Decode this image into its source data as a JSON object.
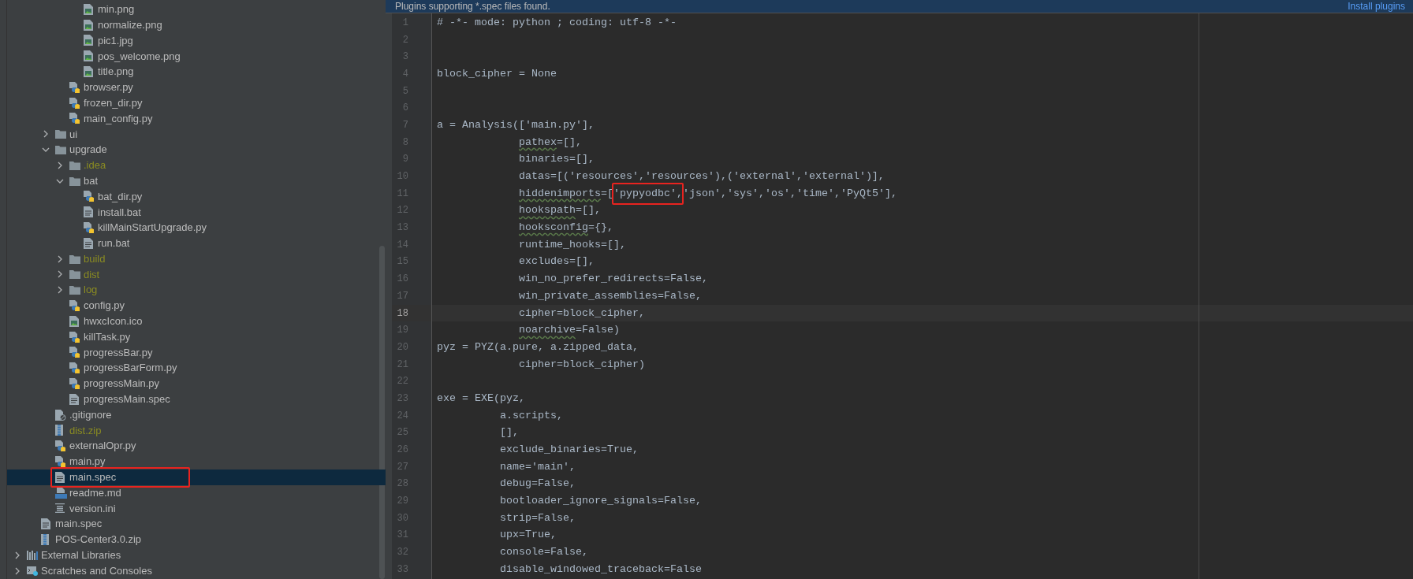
{
  "project_tree": [
    {
      "children": [
        {
          "children": [
            {
              "children": [
                {
                  "children": [
                    {
                      "label": "min.png",
                      "kind": "image",
                      "selected": false,
                      "ignored": false,
                      "boxed": false
                    },
                    {
                      "label": "normalize.png",
                      "kind": "image",
                      "selected": false,
                      "ignored": false,
                      "boxed": false
                    },
                    {
                      "label": "pic1.jpg",
                      "kind": "image",
                      "selected": false,
                      "ignored": false,
                      "boxed": false
                    },
                    {
                      "label": "pos_welcome.png",
                      "kind": "image",
                      "selected": false,
                      "ignored": false,
                      "boxed": false
                    },
                    {
                      "label": "title.png",
                      "kind": "image",
                      "selected": false,
                      "ignored": false,
                      "boxed": false
                    }
                  ]
                },
                {
                  "label": "browser.py",
                  "kind": "python",
                  "selected": false,
                  "ignored": false,
                  "boxed": false
                },
                {
                  "label": "frozen_dir.py",
                  "kind": "python",
                  "selected": false,
                  "ignored": false,
                  "boxed": false
                },
                {
                  "label": "main_config.py",
                  "kind": "python",
                  "selected": false,
                  "ignored": false,
                  "boxed": false
                }
              ]
            },
            {
              "label": "ui",
              "kind": "folder",
              "expanded": false,
              "selected": false,
              "ignored": false,
              "boxed": false
            },
            {
              "label": "upgrade",
              "kind": "folder",
              "expanded": true,
              "selected": false,
              "ignored": false,
              "boxed": false,
              "children": [
                {
                  "label": ".idea",
                  "kind": "folder",
                  "expanded": false,
                  "selected": false,
                  "ignored": true,
                  "boxed": false
                },
                {
                  "label": "bat",
                  "kind": "folder",
                  "expanded": true,
                  "selected": false,
                  "ignored": false,
                  "boxed": false,
                  "children": [
                    {
                      "label": "bat_dir.py",
                      "kind": "python",
                      "selected": false,
                      "ignored": false,
                      "boxed": false
                    },
                    {
                      "label": "install.bat",
                      "kind": "text",
                      "selected": false,
                      "ignored": false,
                      "boxed": false
                    },
                    {
                      "label": "killMainStartUpgrade.py",
                      "kind": "python",
                      "selected": false,
                      "ignored": false,
                      "boxed": false
                    },
                    {
                      "label": "run.bat",
                      "kind": "text",
                      "selected": false,
                      "ignored": false,
                      "boxed": false
                    }
                  ]
                },
                {
                  "label": "build",
                  "kind": "folder",
                  "expanded": false,
                  "selected": false,
                  "ignored": true,
                  "boxed": false
                },
                {
                  "label": "dist",
                  "kind": "folder",
                  "expanded": false,
                  "selected": false,
                  "ignored": true,
                  "boxed": false
                },
                {
                  "label": "log",
                  "kind": "folder",
                  "expanded": false,
                  "selected": false,
                  "ignored": true,
                  "boxed": false
                },
                {
                  "label": "config.py",
                  "kind": "python",
                  "selected": false,
                  "ignored": false,
                  "boxed": false
                },
                {
                  "label": "hwxcIcon.ico",
                  "kind": "image",
                  "selected": false,
                  "ignored": false,
                  "boxed": false
                },
                {
                  "label": "killTask.py",
                  "kind": "python",
                  "selected": false,
                  "ignored": false,
                  "boxed": false
                },
                {
                  "label": "progressBar.py",
                  "kind": "python",
                  "selected": false,
                  "ignored": false,
                  "boxed": false
                },
                {
                  "label": "progressBarForm.py",
                  "kind": "python",
                  "selected": false,
                  "ignored": false,
                  "boxed": false
                },
                {
                  "label": "progressMain.py",
                  "kind": "python",
                  "selected": false,
                  "ignored": false,
                  "boxed": false
                },
                {
                  "label": "progressMain.spec",
                  "kind": "text",
                  "selected": false,
                  "ignored": false,
                  "boxed": false
                }
              ]
            },
            {
              "label": ".gitignore",
              "kind": "gitignore",
              "selected": false,
              "ignored": false,
              "boxed": false
            },
            {
              "label": "dist.zip",
              "kind": "zip",
              "selected": false,
              "ignored": true,
              "boxed": false
            },
            {
              "label": "externalOpr.py",
              "kind": "python",
              "selected": false,
              "ignored": false,
              "boxed": false
            },
            {
              "label": "main.py",
              "kind": "python",
              "selected": false,
              "ignored": false,
              "boxed": false
            },
            {
              "label": "main.spec",
              "kind": "text",
              "selected": true,
              "ignored": false,
              "boxed": true
            },
            {
              "label": "readme.md",
              "kind": "markdown",
              "selected": false,
              "ignored": false,
              "boxed": false
            },
            {
              "label": "version.ini",
              "kind": "ini",
              "selected": false,
              "ignored": false,
              "boxed": false
            }
          ]
        },
        {
          "label": "main.spec",
          "kind": "text",
          "selected": false,
          "ignored": false,
          "boxed": false
        },
        {
          "label": "POS-Center3.0.zip",
          "kind": "zip",
          "selected": false,
          "ignored": false,
          "boxed": false
        }
      ]
    },
    {
      "label": "External Libraries",
      "kind": "libraries",
      "expanded": false,
      "selected": false,
      "ignored": false,
      "boxed": false
    },
    {
      "label": "Scratches and Consoles",
      "kind": "scratches",
      "expanded": false,
      "selected": false,
      "ignored": false,
      "boxed": false
    }
  ],
  "banner": {
    "text": "Plugins supporting *.spec files found.",
    "link": "Install plugins"
  },
  "editor": {
    "lines": [
      {
        "n": "1",
        "current": false,
        "segments": [
          {
            "kind": "plain",
            "text": "# -*- mode: python ; coding: utf-8 -*-"
          }
        ]
      },
      {
        "n": "2",
        "current": false
      },
      {
        "n": "3",
        "current": false
      },
      {
        "n": "4",
        "current": false,
        "segments": [
          {
            "kind": "plain",
            "text": "block_cipher = None"
          }
        ]
      },
      {
        "n": "5",
        "current": false
      },
      {
        "n": "6",
        "current": false
      },
      {
        "n": "7",
        "current": false,
        "segments": [
          {
            "kind": "plain",
            "text": "a = Analysis(['main.py'],"
          }
        ]
      },
      {
        "n": "8",
        "current": false,
        "segments": [
          {
            "kind": "typo",
            "text": "             pathex"
          },
          {
            "kind": "plain",
            "text": "=[],"
          }
        ]
      },
      {
        "n": "9",
        "current": false,
        "segments": [
          {
            "kind": "plain",
            "text": "             binaries=[],"
          }
        ]
      },
      {
        "n": "10",
        "current": false,
        "segments": [
          {
            "kind": "plain",
            "text": "             datas=[('resources','resources'),('external','external')],"
          }
        ]
      },
      {
        "n": "11",
        "current": false,
        "segments": [
          {
            "kind": "typo",
            "text": "             hiddenimports"
          },
          {
            "kind": "plain",
            "text": "=["
          },
          {
            "kind": "boxed",
            "text": "'pypyodbc',"
          },
          {
            "kind": "plain",
            "text": "'json','sys','os','time','PyQt5'],"
          }
        ]
      },
      {
        "n": "12",
        "current": false,
        "segments": [
          {
            "kind": "typo",
            "text": "             hookspath"
          },
          {
            "kind": "plain",
            "text": "=[],"
          }
        ]
      },
      {
        "n": "13",
        "current": false,
        "segments": [
          {
            "kind": "typo",
            "text": "             hooksconfig"
          },
          {
            "kind": "plain",
            "text": "={},"
          }
        ]
      },
      {
        "n": "14",
        "current": false,
        "segments": [
          {
            "kind": "plain",
            "text": "             runtime_hooks=[],"
          }
        ]
      },
      {
        "n": "15",
        "current": false,
        "segments": [
          {
            "kind": "plain",
            "text": "             excludes=[],"
          }
        ]
      },
      {
        "n": "16",
        "current": false,
        "segments": [
          {
            "kind": "plain",
            "text": "             win_no_prefer_redirects=False,"
          }
        ]
      },
      {
        "n": "17",
        "current": false,
        "segments": [
          {
            "kind": "plain",
            "text": "             win_private_assemblies=False,"
          }
        ]
      },
      {
        "n": "18",
        "current": true,
        "segments": [
          {
            "kind": "plain",
            "text": "             cipher=block_cipher,"
          }
        ]
      },
      {
        "n": "19",
        "current": false,
        "segments": [
          {
            "kind": "typo",
            "text": "             noarchive"
          },
          {
            "kind": "plain",
            "text": "=False)"
          }
        ]
      },
      {
        "n": "20",
        "current": false,
        "segments": [
          {
            "kind": "plain",
            "text": "pyz = PYZ(a.pure, a.zipped_data,"
          }
        ]
      },
      {
        "n": "21",
        "current": false,
        "segments": [
          {
            "kind": "plain",
            "text": "             cipher=block_cipher)"
          }
        ]
      },
      {
        "n": "22",
        "current": false
      },
      {
        "n": "23",
        "current": false,
        "segments": [
          {
            "kind": "plain",
            "text": "exe = EXE(pyz,"
          }
        ]
      },
      {
        "n": "24",
        "current": false,
        "segments": [
          {
            "kind": "plain",
            "text": "          a.scripts,"
          }
        ]
      },
      {
        "n": "25",
        "current": false,
        "segments": [
          {
            "kind": "plain",
            "text": "          [],"
          }
        ]
      },
      {
        "n": "26",
        "current": false,
        "segments": [
          {
            "kind": "plain",
            "text": "          exclude_binaries=True,"
          }
        ]
      },
      {
        "n": "27",
        "current": false,
        "segments": [
          {
            "kind": "plain",
            "text": "          name='main',"
          }
        ]
      },
      {
        "n": "28",
        "current": false,
        "segments": [
          {
            "kind": "plain",
            "text": "          debug=False,"
          }
        ]
      },
      {
        "n": "29",
        "current": false,
        "segments": [
          {
            "kind": "plain",
            "text": "          bootloader_ignore_signals=False,"
          }
        ]
      },
      {
        "n": "30",
        "current": false,
        "segments": [
          {
            "kind": "plain",
            "text": "          strip=False,"
          }
        ]
      },
      {
        "n": "31",
        "current": false,
        "segments": [
          {
            "kind": "plain",
            "text": "          upx=True,"
          }
        ]
      },
      {
        "n": "32",
        "current": false,
        "segments": [
          {
            "kind": "plain",
            "text": "          console=False,"
          }
        ]
      },
      {
        "n": "33",
        "current": false,
        "segments": [
          {
            "kind": "plain",
            "text": "          disable_windowed_traceback=False"
          }
        ]
      }
    ]
  }
}
